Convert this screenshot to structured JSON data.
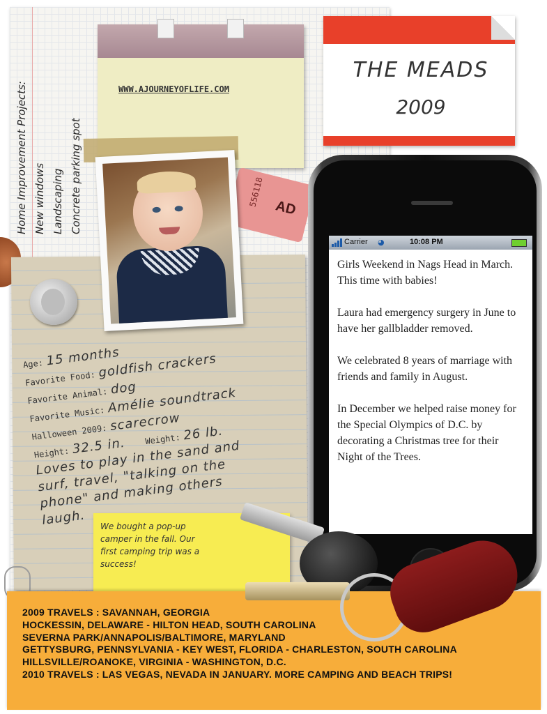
{
  "home_projects": {
    "title": "Home Improvement Projects:",
    "items": [
      "New windows",
      "Landscaping",
      "Concrete parking spot"
    ]
  },
  "calendar_note": {
    "website": "WWW.AJOURNEYOFLIFE.COM"
  },
  "name_label": {
    "name": "THE MEADS",
    "year": "2009"
  },
  "ticket": {
    "number": "556118",
    "admit": "AD"
  },
  "photo": {
    "icon": "baby-photo"
  },
  "facts": {
    "age_label": "Age:",
    "age_value": "15 months",
    "food_label": "Favorite Food:",
    "food_value": "goldfish crackers",
    "animal_label": "Favorite Animal:",
    "animal_value": "dog",
    "music_label": "Favorite Music:",
    "music_value": "Amélie soundtrack",
    "halloween_label": "Halloween 2009:",
    "halloween_value": "scarecrow",
    "height_label": "Height:",
    "height_value": "32.5 in.",
    "weight_label": "Weight:",
    "weight_value": "26 lb.",
    "loves_lines": [
      "Loves to play in the sand and",
      "surf, travel, \"talking on the",
      "phone\" and making others",
      "laugh."
    ]
  },
  "sticky_note": {
    "lines": [
      "We bought a pop-up",
      "camper in the fall.  Our",
      "first camping trip was a",
      "success!"
    ]
  },
  "phone": {
    "carrier": "Carrier",
    "time": "10:08 PM",
    "paragraphs": [
      "Girls Weekend in Nags Head in March.  This time with babies!",
      "Laura had emergency surgery in June to have her gallbladder removed.",
      "We celebrated 8 years of marriage with friends and family in August.",
      "In December we helped raise money for the Special Olympics of D.C. by decorating a Christmas tree for their Night of the Trees."
    ]
  },
  "travels": {
    "lines": [
      "2009 TRAVELS : SAVANNAH, GEORGIA",
      "HOCKESSIN, DELAWARE - HILTON HEAD, SOUTH CAROLINA",
      "SEVERNA PARK/ANNAPOLIS/BALTIMORE, MARYLAND",
      "GETTYSBURG, PENNSYLVANIA - KEY WEST, FLORIDA - CHARLESTON, SOUTH CAROLINA",
      "HILLSVILLE/ROANOKE, VIRGINIA - WASHINGTON, D.C.",
      "2010 TRAVELS : LAS VEGAS, NEVADA IN JANUARY.  MORE CAMPING AND BEACH TRIPS!"
    ]
  }
}
